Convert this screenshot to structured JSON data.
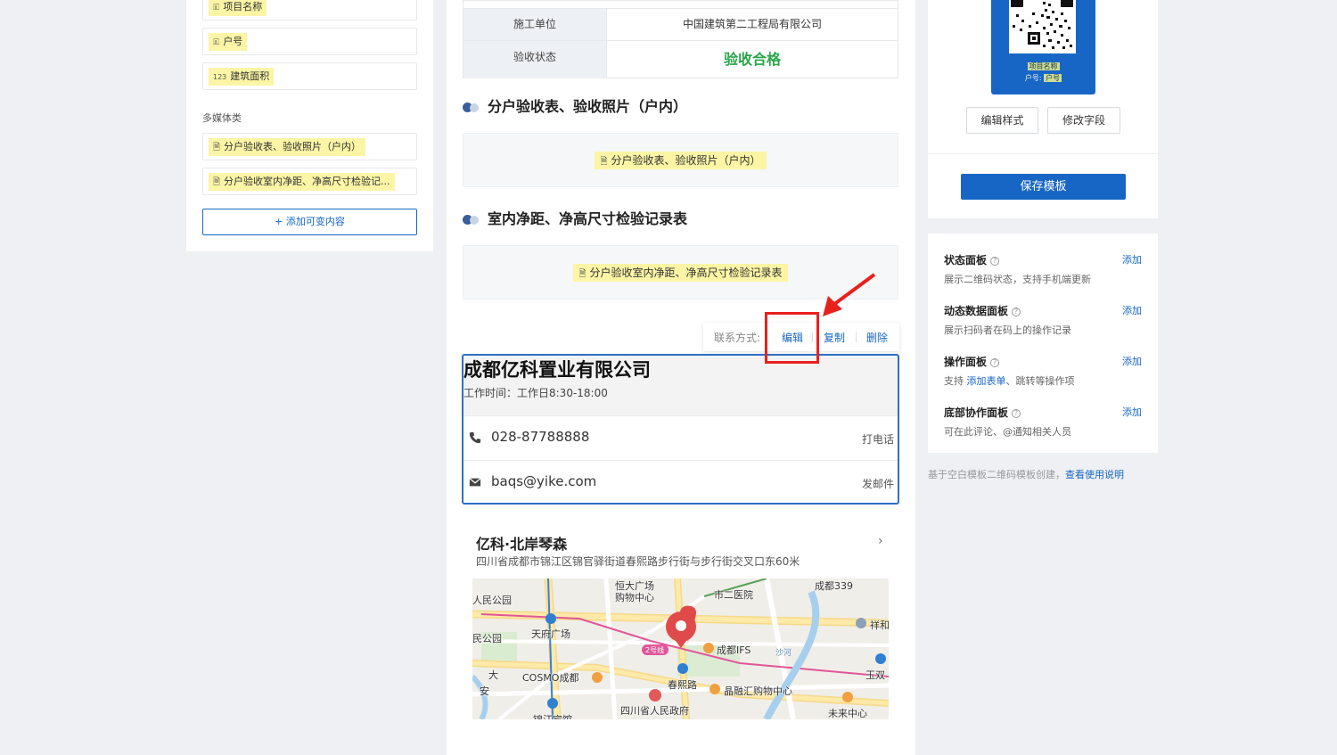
{
  "left_panel": {
    "fields": [
      {
        "icon": "🗉",
        "label": "项目名称"
      },
      {
        "icon": "🗉",
        "label": "户号"
      },
      {
        "icon": "123",
        "label": "建筑面积"
      }
    ],
    "media_section_label": "多媒体类",
    "media_items": [
      {
        "icon": "🗎",
        "label": "分户验收表、验收照片（户内）"
      },
      {
        "icon": "🗎",
        "label": "分户验收室内净距、净高尺寸检验记..."
      }
    ],
    "add_button": "+ 添加可变内容"
  },
  "info_table": {
    "rows": [
      {
        "key": "施工单位",
        "value": "中国建筑第二工程局有限公司"
      },
      {
        "key": "验收状态",
        "value": "验收合格"
      }
    ]
  },
  "sections": [
    {
      "title": "分户验收表、验收照片（户内）",
      "chip": "分户验收表、验收照片（户内）"
    },
    {
      "title": "室内净距、净高尺寸检验记录表",
      "chip": "分户验收室内净距、净高尺寸检验记录表"
    }
  ],
  "contact_toolbar": {
    "label": "联系方式:",
    "edit": "编辑",
    "copy": "复制",
    "delete": "删除"
  },
  "contact_card": {
    "company": "成都亿科置业有限公司",
    "hours": "工作时间：工作日8:30-18:00",
    "phone": "028-87788888",
    "phone_action": "打电话",
    "email": "baqs@yike.com",
    "email_action": "发邮件"
  },
  "address": {
    "title": "亿科·北岸琴森",
    "text": "四川省成都市锦江区锦官驿街道春熙路步行街与步行街交叉口东60米",
    "map_labels": [
      "恒大广场",
      "购物中心",
      "市二医院",
      "成都339",
      "人民公园",
      "祥和",
      "民公园",
      "天府广场",
      "2号线",
      "成都IFS",
      "COSMO成都",
      "春熙路",
      "晶融汇购物中心",
      "玉双",
      "四川省人民政府",
      "未来中心",
      "锦江宾馆",
      "大",
      "安",
      "沙河"
    ]
  },
  "right": {
    "qr_line1": "项目名称",
    "qr_line2_label": "户号:",
    "qr_line2_value": "户号",
    "edit_style": "编辑样式",
    "modify_fields": "修改字段",
    "save_template": "保存模板",
    "panels": [
      {
        "title": "状态面板",
        "desc": "展示二维码状态，支持手机端更新",
        "add": "添加"
      },
      {
        "title": "动态数据面板",
        "desc": "展示扫码者在码上的操作记录",
        "add": "添加"
      },
      {
        "title": "操作面板",
        "desc_pre": "支持",
        "desc_link": "添加表单",
        "desc_post": "、跳转等操作项",
        "add": "添加"
      },
      {
        "title": "底部协作面板",
        "desc": "可在此评论、@通知相关人员",
        "add": "添加"
      }
    ],
    "footnote": "基于空白模板二维码模板创建，",
    "footnote_link": "查看使用说明"
  },
  "colors": {
    "accent": "#1766c6",
    "success": "#2aa54a",
    "highlight": "#fbf5a5",
    "annotation": "#e8211f"
  }
}
